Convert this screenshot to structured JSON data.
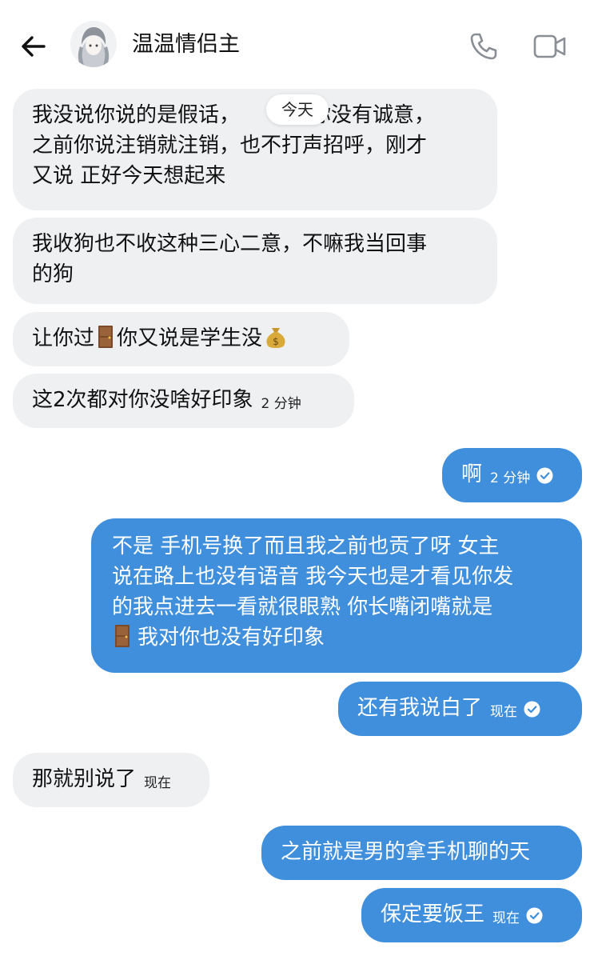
{
  "header": {
    "title": "温温情侣主",
    "back_icon": "arrow-left",
    "call_icon": "phone",
    "video_icon": "video-camera"
  },
  "today_label": "今天",
  "colors": {
    "incoming_bubble": "#eef0f2",
    "outgoing_bubble": "#3f8fdc",
    "outgoing_text": "#ffffff",
    "incoming_text": "#111111"
  },
  "messages": [
    {
      "direction": "incoming",
      "lines": [
        "我没说你说的是假话，",
        "你没有诚意，",
        "之前你说注销就注销，也不打声招呼，刚才",
        "又说 正好今天想起来"
      ]
    },
    {
      "direction": "incoming",
      "lines": [
        "我收狗也不收这种三心二意，不嘛我当回事",
        "的狗"
      ]
    },
    {
      "direction": "incoming",
      "parts": [
        "让你过",
        "你又说是学生没"
      ],
      "emojis": [
        "door",
        "money-bag"
      ]
    },
    {
      "direction": "incoming",
      "text": "这2次都对你没啥好印象",
      "time": "2 分钟"
    },
    {
      "direction": "outgoing",
      "text": "啊",
      "time": "2 分钟",
      "status": "read"
    },
    {
      "direction": "outgoing",
      "lines": [
        "不是 手机号换了而且我之前也贡了呀 女主",
        "说在路上也没有语音 我今天也是才看见你发",
        "的我点进去一看就很眼熟 你长嘴闭嘴就是",
        "我对你也没有好印象"
      ],
      "emojis": [
        "door"
      ]
    },
    {
      "direction": "outgoing",
      "text": "还有我说白了",
      "time": "现在",
      "status": "read"
    },
    {
      "direction": "incoming",
      "text": "那就别说了",
      "time": "现在"
    },
    {
      "direction": "outgoing",
      "text": "之前就是男的拿手机聊的天"
    },
    {
      "direction": "outgoing",
      "text": "保定要饭王",
      "time": "现在",
      "status": "read"
    }
  ]
}
